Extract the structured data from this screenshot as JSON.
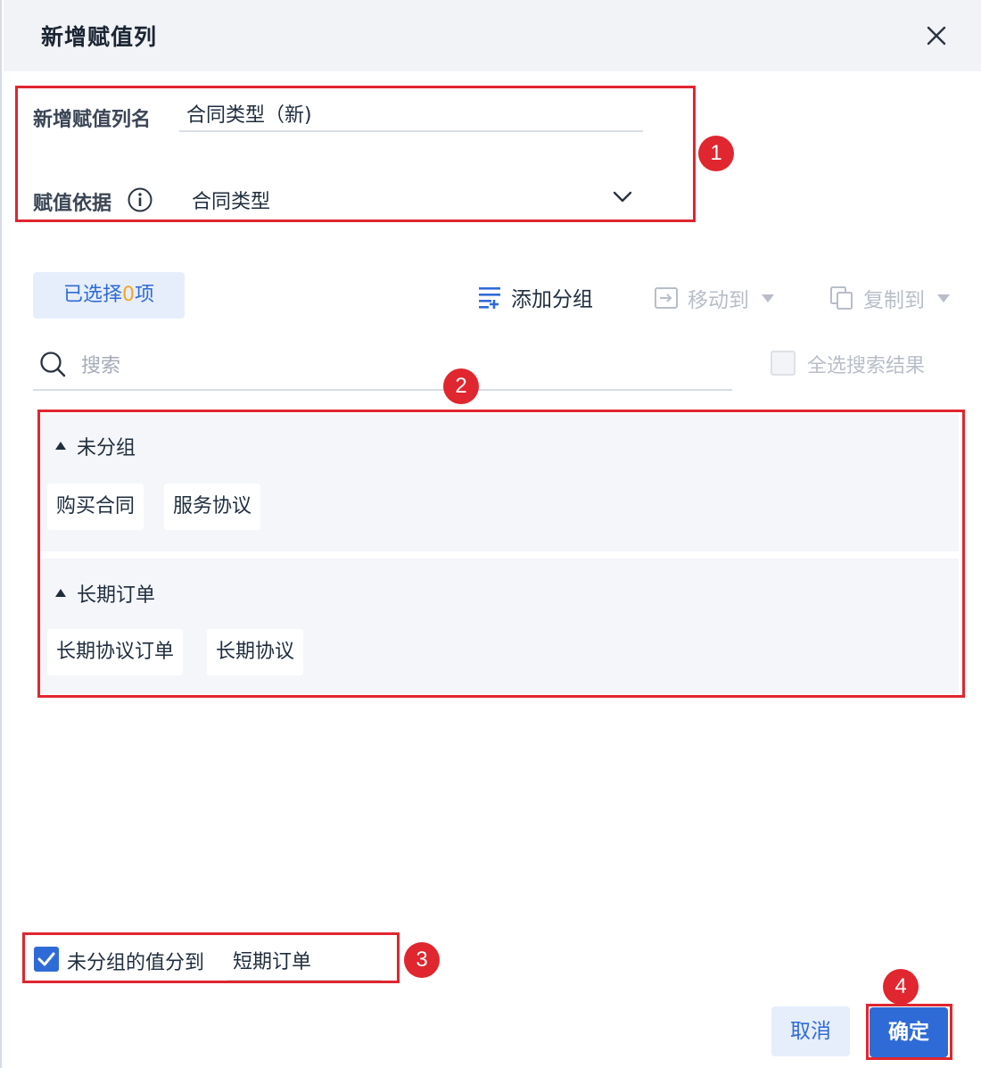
{
  "dialog": {
    "title": "新增赋值列",
    "close_icon": "close-icon"
  },
  "form": {
    "name_label": "新增赋值列名",
    "name_value": "合同类型（新)",
    "basis_label": "赋值依据",
    "basis_value": "合同类型"
  },
  "toolbar": {
    "selected_prefix": "已选择",
    "selected_count": "0",
    "selected_suffix": "项",
    "add_group": "添加分组",
    "move_to": "移动到",
    "copy_to": "复制到"
  },
  "search": {
    "placeholder": "搜索",
    "select_all_label": "全选搜索结果"
  },
  "groups": [
    {
      "name": "未分组",
      "items": [
        "购买合同",
        "服务协议"
      ]
    },
    {
      "name": "长期订单",
      "items": [
        "长期协议订单",
        "长期协议"
      ]
    }
  ],
  "footer": {
    "ungrouped_checked": true,
    "ungrouped_label": "未分组的值分到",
    "ungrouped_target": "短期订单",
    "cancel": "取消",
    "confirm": "确定"
  },
  "annotations": [
    "1",
    "2",
    "3",
    "4"
  ],
  "colors": {
    "accent": "#2f6bd7",
    "annotation": "#e0262f",
    "count_highlight": "#f6a623"
  }
}
